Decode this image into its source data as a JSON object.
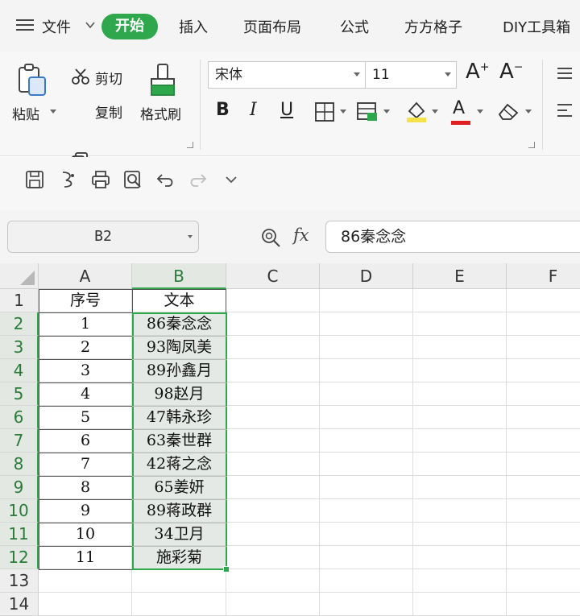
{
  "menu": {
    "file": "文件",
    "active_tab": "开始",
    "tabs": [
      "插入",
      "页面布局",
      "公式",
      "方方格子",
      "DIY工具箱"
    ]
  },
  "ribbon": {
    "paste": "粘贴",
    "cut": "剪切",
    "copy": "复制",
    "format_painter": "格式刷",
    "font_name": "宋体",
    "font_size": "11",
    "bold": "B",
    "italic": "I",
    "underline": "U",
    "grow_font": "A",
    "shrink_font": "A",
    "font_color_letter": "A",
    "accent_color": "#2fa74d",
    "font_color": "#e02020",
    "highlight_color": "#f5e24a"
  },
  "formula_bar": {
    "name_box": "B2",
    "fx": "fx",
    "content": "86秦念念"
  },
  "sheet": {
    "columns": [
      "A",
      "B",
      "C",
      "D",
      "E",
      "F"
    ],
    "rows": [
      "1",
      "2",
      "3",
      "4",
      "5",
      "6",
      "7",
      "8",
      "9",
      "10",
      "11",
      "12",
      "13",
      "14"
    ],
    "header": {
      "a": "序号",
      "b": "文本"
    },
    "data": [
      {
        "a": "1",
        "b": "86秦念念"
      },
      {
        "a": "2",
        "b": "93陶凤美"
      },
      {
        "a": "3",
        "b": "89孙鑫月"
      },
      {
        "a": "4",
        "b": "98赵月"
      },
      {
        "a": "5",
        "b": "47韩永珍"
      },
      {
        "a": "6",
        "b": "63秦世群"
      },
      {
        "a": "7",
        "b": "42蒋之念"
      },
      {
        "a": "8",
        "b": "65姜妍"
      },
      {
        "a": "9",
        "b": "89蒋政群"
      },
      {
        "a": "10",
        "b": "34卫月"
      },
      {
        "a": "11",
        "b": "施彩菊"
      }
    ]
  }
}
